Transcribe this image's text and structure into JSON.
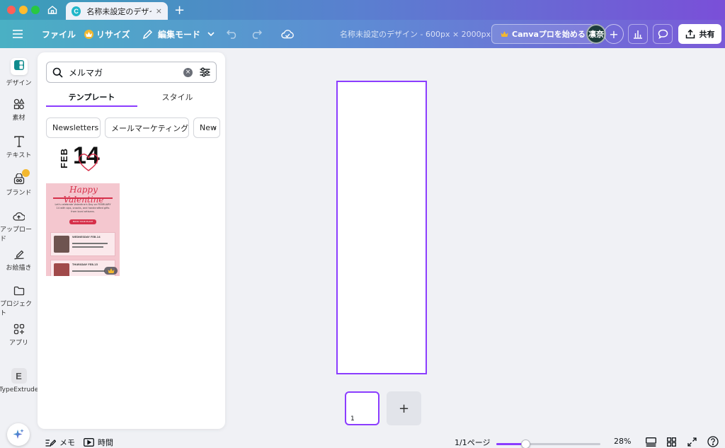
{
  "browser": {
    "tab_title": "名称未設定のデザイ...",
    "favicon_letter": "C",
    "tab_close": "×",
    "new_tab": "+"
  },
  "toolbar": {
    "file_label": "ファイル",
    "resize_label": "リサイズ",
    "edit_mode_label": "編集モード",
    "doc_title": "名称未設定のデザイン - 600px × 2000px",
    "pro_label": "Canvaプロを始める",
    "avatar_initials": "凛奈",
    "share_label": "共有"
  },
  "rail": {
    "items": [
      {
        "label": "デザイン",
        "icon": "design-icon"
      },
      {
        "label": "素材",
        "icon": "elements-icon"
      },
      {
        "label": "テキスト",
        "icon": "text-icon"
      },
      {
        "label": "ブランド",
        "icon": "brand-icon"
      },
      {
        "label": "アップロード",
        "icon": "upload-icon"
      },
      {
        "label": "お絵描き",
        "icon": "draw-icon"
      },
      {
        "label": "プロジェクト",
        "icon": "folder-icon"
      },
      {
        "label": "アプリ",
        "icon": "apps-icon"
      },
      {
        "label": "TypeExtrude",
        "icon": "typeextrude-icon"
      }
    ],
    "typeextrude_letter": "E"
  },
  "panel": {
    "search_value": "メルマガ",
    "tabs": [
      {
        "label": "テンプレート",
        "active": true
      },
      {
        "label": "スタイル",
        "active": false
      }
    ],
    "chips": [
      "Newsletters",
      "メールマーケティング",
      "New"
    ],
    "template": {
      "feb": "FEB",
      "day": "14",
      "headline": "Happy Valentine",
      "body": "Let's celebrate Valentine's Day on FEBRUARY 14 with sips, snacks, and handcrafted gifts from local artisans.",
      "button": "BOOK YOUR PLACE",
      "events": [
        "WEDNESDAY FEB.14",
        "THURSDAY FEB.15"
      ]
    }
  },
  "canvas": {
    "page_number": "1",
    "add_page": "+"
  },
  "bottombar": {
    "notes_label": "メモ",
    "timer_label": "時間",
    "page_count": "1/1ページ",
    "zoom_value": "28%",
    "zoom_fraction": 0.28
  },
  "colors": {
    "accent": "#8b3dff",
    "crown": "#f3b82f"
  }
}
